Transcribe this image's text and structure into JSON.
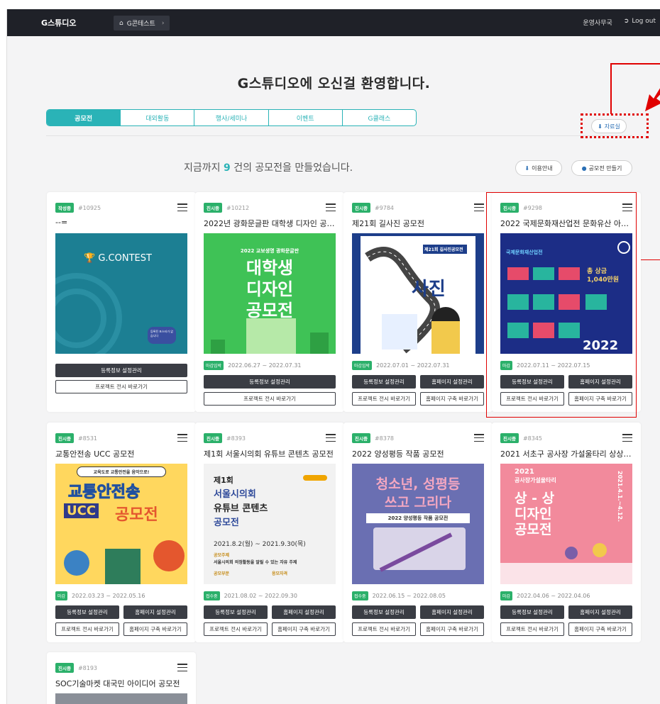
{
  "topbar": {
    "brand": "G스튜디오",
    "breadcrumb": "G콘테스트",
    "user": "운영사무국",
    "logout": "Log out"
  },
  "welcome": "G스튜디오에 오신걸 환영합니다.",
  "tabs": [
    "공모전",
    "대외활동",
    "행사/세미나",
    "이벤트",
    "G클래스"
  ],
  "resources_label": "자료실",
  "summary": {
    "prefix": "지금까지",
    "count": "9",
    "suffix": "건의 공모전을 만들었습니다."
  },
  "guide_label": "이용안내",
  "create_label": "공모전 만들기",
  "colors": {
    "accent": "#2ab3b7",
    "topbar": "#1f2128",
    "badge": "#2bb06a",
    "dark_button": "#3a3d44",
    "highlight": "#e00000"
  },
  "buttons": {
    "reg": "등록정보 설정관리",
    "home": "홈페이지 설정관리",
    "exhibit": "프로젝트 전시 바로가기",
    "homebuild": "홈페이지 구축 바로가기"
  },
  "cards": [
    {
      "badge": "작성중",
      "id": "#10925",
      "title": "--=",
      "poster_text": "G.CONTEST",
      "poster_sub": "등록된 포스터가 없습니다"
    },
    {
      "badge": "진시중",
      "id": "#10212",
      "title": "2022년 광화문글판 대학생 디자인 공…",
      "date_badge": "마감임박",
      "date": "2022.06.27 ~ 2022.07.31",
      "poster_top": "2022 교보생명 광화문글판",
      "poster_lines": [
        "대학생",
        "디자인",
        "공모전"
      ]
    },
    {
      "badge": "진시중",
      "id": "#9784",
      "title": "제21회 길사진 공모전",
      "date_badge": "마감임박",
      "date": "2022.07.01 ~ 2022.07.31",
      "poster_sign": "제21회 길사진공모전",
      "poster_word": "사진"
    },
    {
      "badge": "진시중",
      "id": "#9298",
      "title": "2022 국제문화재산업전 문화유산 아…",
      "date_badge": "마감",
      "date": "2022.07.11 ~ 2022.07.15",
      "poster_org": "국제문화재산업전",
      "poster_prize": "총 상금",
      "poster_amount": "1,040만원",
      "poster_year": "2022"
    },
    {
      "badge": "진시중",
      "id": "#8531",
      "title": "교통안전송 UCC 공모전",
      "date_badge": "마감",
      "date": "2022.03.23 ~ 2022.05.16",
      "poster_ribbon": "교육도로 교통안전을 음악으로!",
      "poster_a": "교통안전송",
      "poster_b": "UCC",
      "poster_c": "공모전"
    },
    {
      "badge": "진시중",
      "id": "#8393",
      "title": "제1회 서울시의회 유튜브 콘텐츠 공모전",
      "date_badge": "접수중",
      "date": "2021.08.02 ~ 2022.09.30",
      "poster_lines": [
        "제1회",
        "서울시의회",
        "유튜브 콘텐츠",
        "공모전"
      ],
      "poster_period": "2021.8.2(월) ~ 2021.9.30(목)",
      "poster_topic_label": "공모주제",
      "poster_topic": "서울시의회 의정활동을 알릴 수 있는 자유 주제",
      "poster_field": "공모부문",
      "poster_qual": "응모자격"
    },
    {
      "badge": "진시중",
      "id": "#8378",
      "title": "2022 양성평등 작품 공모전",
      "date_badge": "접수중",
      "date": "2022.06.15 ~ 2022.08.05",
      "poster_a": "청소년, 성평등",
      "poster_b": "쓰고 그리다",
      "poster_c": "2022 양성평등 작품 공모전"
    },
    {
      "badge": "진시중",
      "id": "#8345",
      "title": "2021 서초구 공사장 가설울타리 상상…",
      "date_badge": "마감",
      "date": "2022.04.06 ~ 2022.04.06",
      "poster_year": "2021",
      "poster_sub": "공사장가설울타리",
      "poster_lines": [
        "상 - 상",
        "디자인",
        "공모전"
      ],
      "poster_side": "2021.4.1.~4.12."
    },
    {
      "badge": "진시중",
      "id": "#8193",
      "title": "SOC기술마켓 대국민 아이디어 공모전"
    }
  ]
}
